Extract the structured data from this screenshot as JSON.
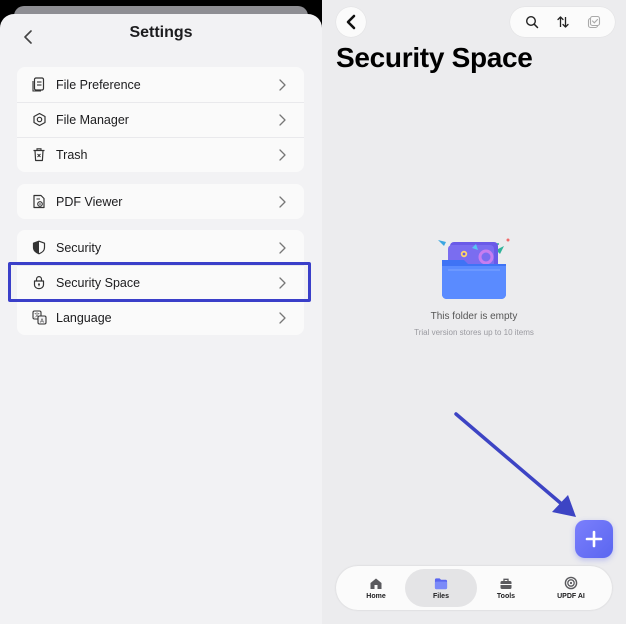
{
  "settings": {
    "title": "Settings",
    "groups": [
      {
        "items": [
          {
            "label": "File Preference",
            "icon": "file-preference-icon"
          },
          {
            "label": "File Manager",
            "icon": "file-manager-icon"
          },
          {
            "label": "Trash",
            "icon": "trash-icon"
          }
        ]
      },
      {
        "items": [
          {
            "label": "PDF Viewer",
            "icon": "pdf-viewer-icon"
          }
        ]
      },
      {
        "items": [
          {
            "label": "Security",
            "icon": "shield-icon"
          },
          {
            "label": "Security Space",
            "icon": "lock-icon"
          },
          {
            "label": "Language",
            "icon": "language-icon"
          }
        ]
      }
    ]
  },
  "security_space": {
    "title": "Security Space",
    "empty_title": "This folder is empty",
    "empty_subtitle": "Trial version stores up to 10 items",
    "tabs": [
      {
        "label": "Home",
        "icon": "home-icon",
        "active": false
      },
      {
        "label": "Files",
        "icon": "folder-icon",
        "active": true
      },
      {
        "label": "Tools",
        "icon": "toolbox-icon",
        "active": false
      },
      {
        "label": "UPDF AI",
        "icon": "ai-icon",
        "active": false
      }
    ]
  },
  "colors": {
    "highlight": "#3a3fc9",
    "accent": "#5a66f0",
    "arrow": "#3d44c4"
  }
}
